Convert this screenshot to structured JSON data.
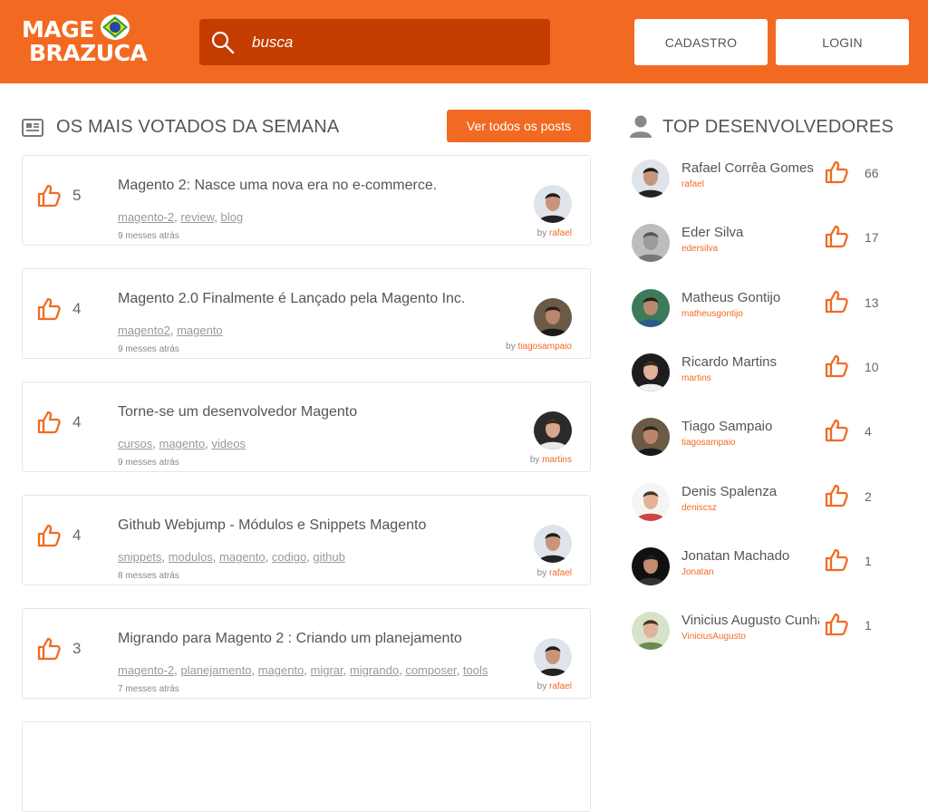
{
  "header": {
    "logo_line1": "MAGE",
    "logo_line2": "BRAZUCA",
    "search_placeholder": "busca",
    "cadastro_label": "CADASTRO",
    "login_label": "LOGIN"
  },
  "colors": {
    "brand": "#f26a21",
    "search_bg": "#c33c00"
  },
  "posts_section": {
    "title": "OS MAIS VOTADOS DA SEMANA",
    "view_all_label": "Ver todos os posts",
    "posts": [
      {
        "votes": "5",
        "title": "Magento 2: Nasce uma nova era no e-commerce.",
        "tags": [
          "magento-2",
          "review",
          "blog"
        ],
        "time": "9 messes atrás",
        "by": "by",
        "author": "rafael"
      },
      {
        "votes": "4",
        "title": "Magento 2.0 Finalmente é Lançado pela Magento Inc.",
        "tags": [
          "magento2",
          "magento"
        ],
        "time": "9 messes atrás",
        "by": "by",
        "author": "tiagosampaio"
      },
      {
        "votes": "4",
        "title": "Torne-se um desenvolvedor Magento",
        "tags": [
          "cursos",
          "magento",
          "videos"
        ],
        "time": "9 messes atrás",
        "by": "by",
        "author": "martins"
      },
      {
        "votes": "4",
        "title": "Github Webjump - Módulos e Snippets Magento",
        "tags": [
          "snippets",
          "modulos",
          "magento",
          "codigo",
          "github"
        ],
        "time": "8 messes atrás",
        "by": "by",
        "author": "rafael"
      },
      {
        "votes": "3",
        "title": "Migrando para Magento 2 : Criando um planejamento",
        "tags": [
          "magento-2",
          "planejamento",
          "magento",
          "migrar",
          "migrando",
          "composer",
          "tools"
        ],
        "time": "7 messes atrás",
        "by": "by",
        "author": "rafael"
      }
    ]
  },
  "devs_section": {
    "title": "TOP DESENVOLVEDORES",
    "devs": [
      {
        "name": "Rafael Corrêa Gomes",
        "username": "rafael",
        "votes": "66"
      },
      {
        "name": "Eder Silva",
        "username": "edersilva",
        "votes": "17"
      },
      {
        "name": "Matheus Gontijo",
        "username": "matheusgontijo",
        "votes": "13"
      },
      {
        "name": "Ricardo Martins",
        "username": "martins",
        "votes": "10"
      },
      {
        "name": "Tiago Sampaio",
        "username": "tiagosampaio",
        "votes": "4"
      },
      {
        "name": "Denis Spalenza",
        "username": "deniscsz",
        "votes": "2"
      },
      {
        "name": "Jonatan Machado",
        "username": "Jonatan",
        "votes": "1"
      },
      {
        "name": "Vinicius Augusto Cunha",
        "username": "ViniciusAugusto",
        "votes": "1"
      }
    ]
  }
}
